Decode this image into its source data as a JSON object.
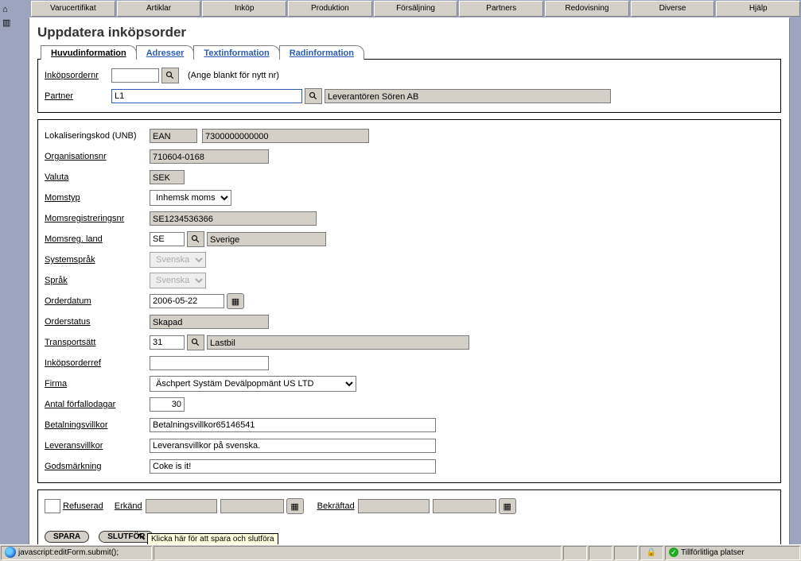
{
  "topmenu": [
    "Varucertifikat",
    "Artiklar",
    "Inköp",
    "Produktion",
    "Försäljning",
    "Partners",
    "Redovisning",
    "Diverse",
    "Hjälp"
  ],
  "title": "Uppdatera inköpsorder",
  "subtabs": [
    "Huvudinformation",
    "Adresser",
    "Textinformation",
    "Radinformation"
  ],
  "section1": {
    "ordernr_label": "Inköpsordernr",
    "ordernr": "",
    "ordernr_hint": "(Ange blankt för nytt nr)",
    "partner_label": "Partner",
    "partner_code": "L1",
    "partner_name": "Leverantören Sören AB"
  },
  "section2": {
    "loc_label": "Lokaliseringskod (UNB)",
    "loc_type": "EAN",
    "loc_code": "7300000000000",
    "org_label": "Organisationsnr",
    "org": "710604-0168",
    "valuta_label": "Valuta",
    "valuta": "SEK",
    "momstyp_label": "Momstyp",
    "momstyp": "Inhemsk moms",
    "momsreg_label": "Momsregistreringsnr",
    "momsreg": "SE1234536366",
    "momsland_label": "Momsreg. land",
    "momsland_code": "SE",
    "momsland_name": "Sverige",
    "sysspr_label": "Systemspråk",
    "sysspr": "Svenska",
    "sprak_label": "Språk",
    "sprak": "Svenska",
    "orderdatum_label": "Orderdatum",
    "orderdatum": "2006-05-22",
    "orderstatus_label": "Orderstatus",
    "orderstatus": "Skapad",
    "transport_label": "Transportsätt",
    "transport_code": "31",
    "transport_name": "Lastbil",
    "orderref_label": "Inköpsorderref",
    "orderref": "",
    "firma_label": "Firma",
    "firma": "Äschpert Systäm Devälpopmänt US LTD",
    "forfall_label": "Antal förfallodagar",
    "forfall": "30",
    "betvillkor_label": "Betalningsvillkor",
    "betvillkor": "Betalningsvillkor65146541",
    "levvillkor_label": "Leveransvillkor",
    "levvillkor": "Leveransvillkor på svenska.",
    "godsmark_label": "Godsmärkning",
    "godsmark": "Coke is it!"
  },
  "section3": {
    "refuserad": "Refuserad",
    "erkand": "Erkänd",
    "erkand_v1": "",
    "erkand_v2": "",
    "bekraftad": "Bekräftad",
    "bekraftad_v1": "",
    "bekraftad_v2": ""
  },
  "buttons": {
    "spara": "SPARA",
    "slutfor": "SLUTFÖR"
  },
  "tooltip": "Klicka här för att spara och slutföra",
  "status": {
    "left": "javascript:editForm.submit();",
    "right": "Tillförlitliga platser"
  }
}
